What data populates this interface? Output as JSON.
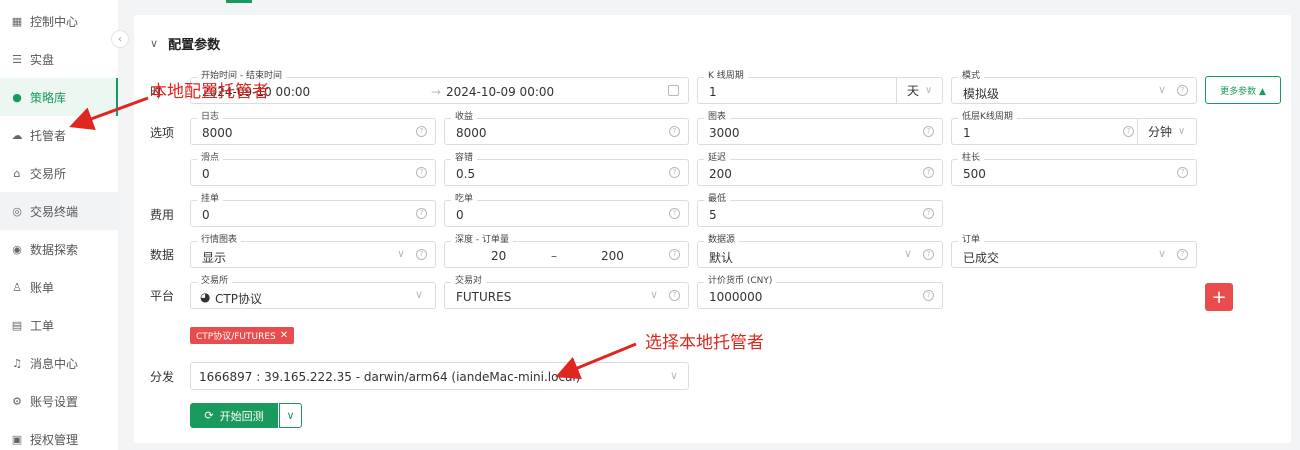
{
  "sidebar": {
    "items": [
      {
        "label": "控制中心",
        "icon": "dashboard-icon"
      },
      {
        "label": "实盘",
        "icon": "list-icon"
      },
      {
        "label": "策略库",
        "icon": "strategy-icon"
      },
      {
        "label": "托管者",
        "icon": "cloud-icon"
      },
      {
        "label": "交易所",
        "icon": "bank-icon"
      },
      {
        "label": "交易终端",
        "icon": "terminal-icon"
      },
      {
        "label": "数据探索",
        "icon": "explore-icon"
      },
      {
        "label": "账单",
        "icon": "user-bill-icon"
      },
      {
        "label": "工单",
        "icon": "ticket-icon"
      },
      {
        "label": "消息中心",
        "icon": "bell-icon"
      },
      {
        "label": "账号设置",
        "icon": "settings-icon"
      },
      {
        "label": "授权管理",
        "icon": "auth-icon"
      }
    ],
    "active_item": "策略库"
  },
  "section": {
    "title": "配置参数"
  },
  "row_labels": {
    "time": "时",
    "options": "选项",
    "fees": "费用",
    "data": "数据",
    "platform": "平台",
    "distribute": "分发"
  },
  "time_range": {
    "label": "开始时间 - 结束时间",
    "start": "2024-09-10 00:00",
    "end": "2024-10-09 00:00"
  },
  "kline_period": {
    "label": "K 线周期",
    "value": "1",
    "unit": "天"
  },
  "mode": {
    "label": "模式",
    "value": "模拟级"
  },
  "more_params_button": "更多参数 ▲",
  "options": {
    "log": {
      "label": "日志",
      "value": "8000"
    },
    "profit": {
      "label": "收益",
      "value": "8000"
    },
    "chart": {
      "label": "图表",
      "value": "3000"
    },
    "low_kline": {
      "label": "低层K线周期",
      "value": "1",
      "unit": "分钟"
    },
    "slippage": {
      "label": "滑点",
      "value": "0"
    },
    "tolerance": {
      "label": "容错",
      "value": "0.5"
    },
    "delay": {
      "label": "延迟",
      "value": "200"
    },
    "bar_len": {
      "label": "柱长",
      "value": "500"
    }
  },
  "fees": {
    "maker": {
      "label": "挂单",
      "value": "0"
    },
    "taker": {
      "label": "吃单",
      "value": "0"
    },
    "min": {
      "label": "最低",
      "value": "5"
    }
  },
  "data": {
    "market_chart": {
      "label": "行情图表",
      "value": "显示"
    },
    "depth": {
      "label": "深度 - 订单量",
      "from": "20",
      "sep": "–",
      "to": "200"
    },
    "source": {
      "label": "数据源",
      "value": "默认"
    },
    "order": {
      "label": "订单",
      "value": "已成交"
    }
  },
  "platform": {
    "exchange": {
      "label": "交易所",
      "value": "CTP协议"
    },
    "pair": {
      "label": "交易对",
      "value": "FUTURES"
    },
    "quote": {
      "label": "计价货币 (CNY)",
      "value": "1000000"
    },
    "add_button": "+"
  },
  "tag": {
    "label": "CTP协议/FUTURES",
    "close": "✕"
  },
  "distribute": {
    "value": "1666897 : 39.165.222.35 - darwin/arm64 (iandeMac-mini.local)"
  },
  "run_button": "开始回测",
  "annotations": {
    "local_host": "本地配置托管者",
    "select_host": "选择本地托管者"
  },
  "colors": {
    "accent": "#1a9a5c",
    "danger": "#e84c4c",
    "annotation": "#e0261f"
  }
}
